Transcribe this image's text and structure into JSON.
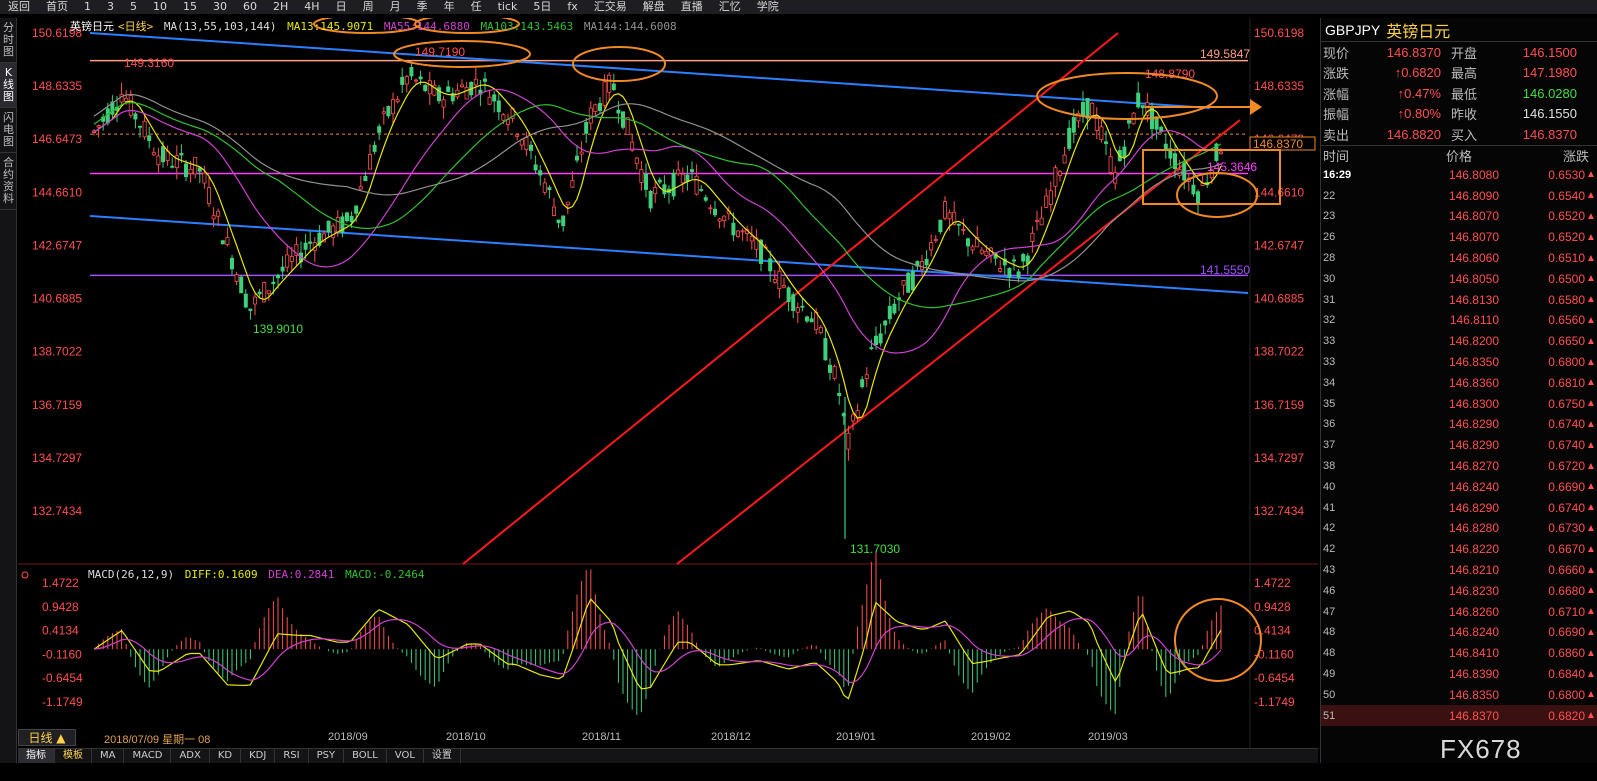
{
  "toolbar": {
    "items": [
      "返回",
      "首页",
      "1",
      "3",
      "5",
      "10",
      "15",
      "30",
      "60",
      "2H",
      "4H",
      "日",
      "周",
      "月",
      "季",
      "年",
      "任",
      "tick",
      "5日",
      "fx",
      "汇交易",
      "解盘",
      "直播",
      "汇忆",
      "学院"
    ]
  },
  "sidebar": {
    "tabs": [
      "分时图",
      "K线图",
      "闪电图",
      "合约资料"
    ]
  },
  "kline": {
    "title": "英镑日元",
    "period": "<日线>",
    "ma_def": "MA(13,55,103,144)",
    "ma13": "MA13:145.9071",
    "ma55": "MA55:144.6880",
    "ma103": "MA103:143.5463",
    "ma144": "MA144:144.6008",
    "y_ticks": [
      "150.6198",
      "148.6335",
      "146.6473",
      "144.6610",
      "142.6747",
      "140.6885",
      "138.7022",
      "136.7159",
      "134.7297",
      "132.7434"
    ],
    "annotations": {
      "high1": "149.3160",
      "high2": "149.7190",
      "high3": "148.8790",
      "low1": "139.9010",
      "low2": "131.7030",
      "line_upper": "149.5847",
      "line_lower": "141.5550",
      "line_mid": "145.3646",
      "last_price": "146.8370"
    }
  },
  "macd": {
    "def": "MACD(26,12,9)",
    "diff": "DIFF:0.1609",
    "dea": "DEA:0.2841",
    "macd": "MACD:-0.2464",
    "y_ticks": [
      "1.4722",
      "0.9428",
      "0.4134",
      "-0.1160",
      "-0.6454",
      "-1.1749"
    ]
  },
  "xaxis": {
    "period_btn": "日线 ▲",
    "cursor_date": "2018/07/09 星期一 08",
    "ticks": [
      "2018/09",
      "2018/10",
      "2018/11",
      "2018/12",
      "2019/01",
      "2019/02",
      "2019/03"
    ]
  },
  "indicators": [
    "指标",
    "模板",
    "MA",
    "MACD",
    "ADX",
    "KD",
    "KDJ",
    "RSI",
    "PSY",
    "BOLL",
    "VOL",
    "设置"
  ],
  "quote": {
    "code": "GBPJPY",
    "name": "英镑日元",
    "rows": [
      {
        "l1": "现价",
        "v1": "146.8370",
        "l2": "开盘",
        "v2": "146.1500"
      },
      {
        "l1": "涨跌",
        "v1": "↑0.6820",
        "l2": "最高",
        "v2": "147.1980"
      },
      {
        "l1": "涨幅",
        "v1": "↑0.47%",
        "l2": "最低",
        "v2": "146.0280"
      },
      {
        "l1": "振幅",
        "v1": "↑0.80%",
        "l2": "昨收",
        "v2": "146.1550"
      },
      {
        "l1": "卖出",
        "v1": "146.8820",
        "l2": "买入",
        "v2": "146.8370"
      }
    ],
    "tick_header": [
      "时间",
      "价格",
      "涨跌"
    ],
    "ticks": [
      {
        "t": "16:29",
        "p": "146.8080",
        "c": "0.6530"
      },
      {
        "t": "22",
        "p": "146.8090",
        "c": "0.6540"
      },
      {
        "t": "23",
        "p": "146.8070",
        "c": "0.6520"
      },
      {
        "t": "26",
        "p": "146.8070",
        "c": "0.6520"
      },
      {
        "t": "28",
        "p": "146.8060",
        "c": "0.6510"
      },
      {
        "t": "30",
        "p": "146.8050",
        "c": "0.6500"
      },
      {
        "t": "31",
        "p": "146.8130",
        "c": "0.6580"
      },
      {
        "t": "32",
        "p": "146.8110",
        "c": "0.6560"
      },
      {
        "t": "33",
        "p": "146.8200",
        "c": "0.6650"
      },
      {
        "t": "33",
        "p": "146.8350",
        "c": "0.6800"
      },
      {
        "t": "34",
        "p": "146.8360",
        "c": "0.6810"
      },
      {
        "t": "35",
        "p": "146.8300",
        "c": "0.6750"
      },
      {
        "t": "36",
        "p": "146.8290",
        "c": "0.6740"
      },
      {
        "t": "37",
        "p": "146.8290",
        "c": "0.6740"
      },
      {
        "t": "38",
        "p": "146.8270",
        "c": "0.6720"
      },
      {
        "t": "40",
        "p": "146.8240",
        "c": "0.6690"
      },
      {
        "t": "41",
        "p": "146.8290",
        "c": "0.6740"
      },
      {
        "t": "42",
        "p": "146.8280",
        "c": "0.6730"
      },
      {
        "t": "42",
        "p": "146.8220",
        "c": "0.6670"
      },
      {
        "t": "43",
        "p": "146.8210",
        "c": "0.6660"
      },
      {
        "t": "46",
        "p": "146.8230",
        "c": "0.6680"
      },
      {
        "t": "47",
        "p": "146.8260",
        "c": "0.6710"
      },
      {
        "t": "48",
        "p": "146.8240",
        "c": "0.6690"
      },
      {
        "t": "48",
        "p": "146.8410",
        "c": "0.6860"
      },
      {
        "t": "49",
        "p": "146.8390",
        "c": "0.6840"
      },
      {
        "t": "50",
        "p": "146.8350",
        "c": "0.6800"
      },
      {
        "t": "51",
        "p": "146.8370",
        "c": "0.6820"
      }
    ]
  },
  "watermark": "FX678",
  "colors": {
    "up": "#ff4f4f",
    "down": "#3ecf7a",
    "ma13": "#e8e800",
    "ma55": "#d040d0",
    "ma103": "#30c030",
    "ma144": "#909090",
    "accent": "#ffd24a",
    "annot": "#f08a24",
    "trend": "#2a80ff",
    "channel": "#ff1a1a"
  }
}
